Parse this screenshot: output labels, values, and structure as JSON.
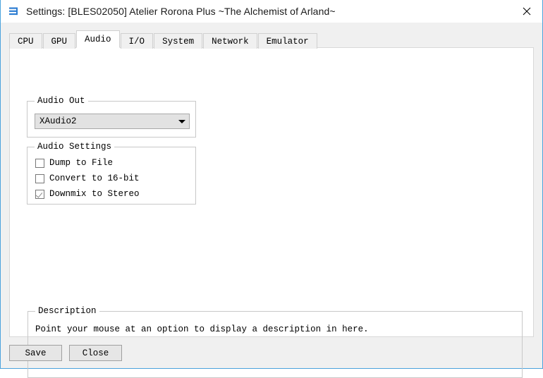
{
  "window": {
    "title": "Settings: [BLES02050] Atelier Rorona Plus ~The Alchemist of Arland~",
    "icon": "rpcs3-logo-icon",
    "close_icon": "close-icon",
    "accent_color": "#4ba3dd",
    "chrome_color": "#f0f0f0"
  },
  "tabs": [
    {
      "label": "CPU",
      "selected": false
    },
    {
      "label": "GPU",
      "selected": false
    },
    {
      "label": "Audio",
      "selected": true
    },
    {
      "label": "I/O",
      "selected": false
    },
    {
      "label": "System",
      "selected": false
    },
    {
      "label": "Network",
      "selected": false
    },
    {
      "label": "Emulator",
      "selected": false
    }
  ],
  "audio_out": {
    "group_title": "Audio Out",
    "selected": "XAudio2",
    "options": [
      "XAudio2"
    ],
    "arrow_icon": "chevron-down-icon"
  },
  "audio_settings": {
    "group_title": "Audio Settings",
    "items": [
      {
        "label": "Dump to File",
        "checked": false
      },
      {
        "label": "Convert to 16-bit",
        "checked": false
      },
      {
        "label": "Downmix to Stereo",
        "checked": true
      }
    ]
  },
  "description": {
    "group_title": "Description",
    "text": "Point your mouse at an option to display a description in here."
  },
  "footer": {
    "save_label": "Save",
    "close_label": "Close"
  }
}
